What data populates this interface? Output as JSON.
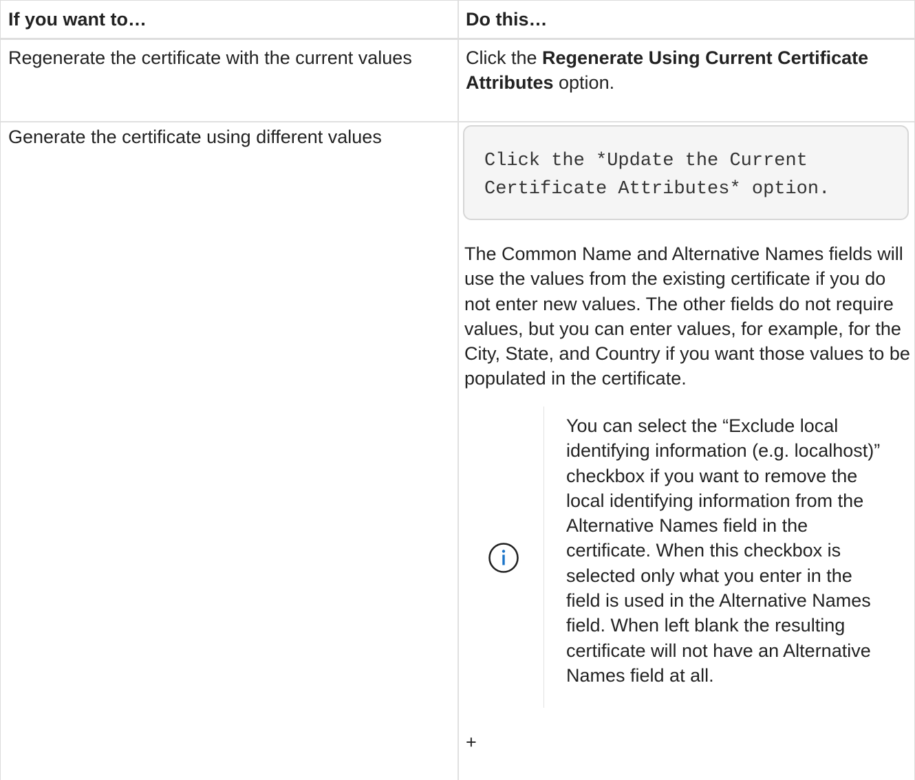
{
  "table": {
    "headers": {
      "col1": "If you want to…",
      "col2": "Do this…"
    },
    "row1": {
      "col1": "Regenerate the certificate with the current values",
      "col2_prefix": "Click the",
      "col2_bold": "Regenerate Using Current Certificate Attributes",
      "col2_suffix": "option."
    },
    "row2": {
      "col1": "Generate the certificate using different values",
      "code_line1": "Click the *Update the Current",
      "code_line2": "Certificate Attributes* option.",
      "paragraph": "The Common Name and Alternative Names fields will use the values from the existing certificate if you do not enter new values. The other fields do not require values, but you can enter values, for example, for the City, State, and Country if you want those values to be populated in the certificate.",
      "note_icon": "info-icon",
      "note_text": "You can select the “Exclude local identifying information (e.g. localhost)” checkbox if you want to remove the local identifying information from the Alternative Names field in the certificate. When this checkbox is selected only what you enter in the field is used in the Alternative Names field. When left blank the resulting certificate will not have an Alternative Names field at all.",
      "trailing": "+"
    }
  },
  "colors": {
    "text": "#222222",
    "border": "#e0e0e0",
    "code_bg": "#f5f5f5",
    "info_icon": "#1a73c8"
  }
}
